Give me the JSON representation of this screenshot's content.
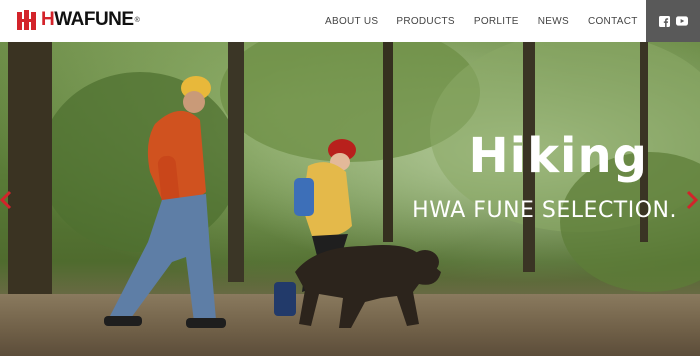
{
  "brand": {
    "logo_text_red": "H",
    "logo_text_rest": "WAFUNE",
    "logo_reg": "®",
    "accent_color": "#d3232a"
  },
  "nav": {
    "items": [
      {
        "label": "ABOUT US"
      },
      {
        "label": "PRODUCTS"
      },
      {
        "label": "PORLITE"
      },
      {
        "label": "NEWS"
      },
      {
        "label": "CONTACT"
      }
    ]
  },
  "social": {
    "icons": [
      "facebook-icon",
      "youtube-icon"
    ],
    "bg_color": "#595959"
  },
  "hero": {
    "title": "Hiking",
    "subtitle": "HWA FUNE SELECTION.",
    "arrow_color": "#d3232a"
  }
}
